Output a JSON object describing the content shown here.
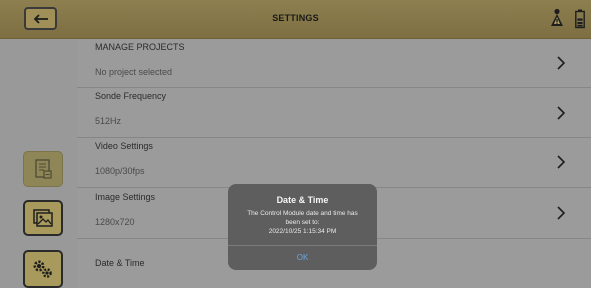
{
  "header": {
    "title": "SETTINGS",
    "back_icon": "arrow-left-icon",
    "right_icons": [
      "warning-person-icon",
      "battery-icon"
    ]
  },
  "rail": {
    "buttons": [
      {
        "icon": "report-icon"
      },
      {
        "icon": "image-icon"
      },
      {
        "icon": "gears-icon"
      }
    ]
  },
  "settings": {
    "items": [
      {
        "title": "MANAGE PROJECTS",
        "value": "No project selected"
      },
      {
        "title": "Sonde Frequency",
        "value": "512Hz"
      },
      {
        "title": "Video Settings",
        "value": "1080p/30fps"
      },
      {
        "title": "Image Settings",
        "value": "1280x720"
      },
      {
        "title": "Date & Time",
        "value": ""
      }
    ]
  },
  "dialog": {
    "title": "Date & Time",
    "message_line1": "The Control Module date and time has",
    "message_line2": "been set to:",
    "message_line3": "2022/10/25 1:15:34 PM",
    "ok_label": "OK"
  },
  "colors": {
    "header": "#857848",
    "background": "#9b9b9b",
    "rail_button": "#a89a5c",
    "dialog_bg": "#5a5a5a",
    "ok_link": "#6aa6e8"
  }
}
